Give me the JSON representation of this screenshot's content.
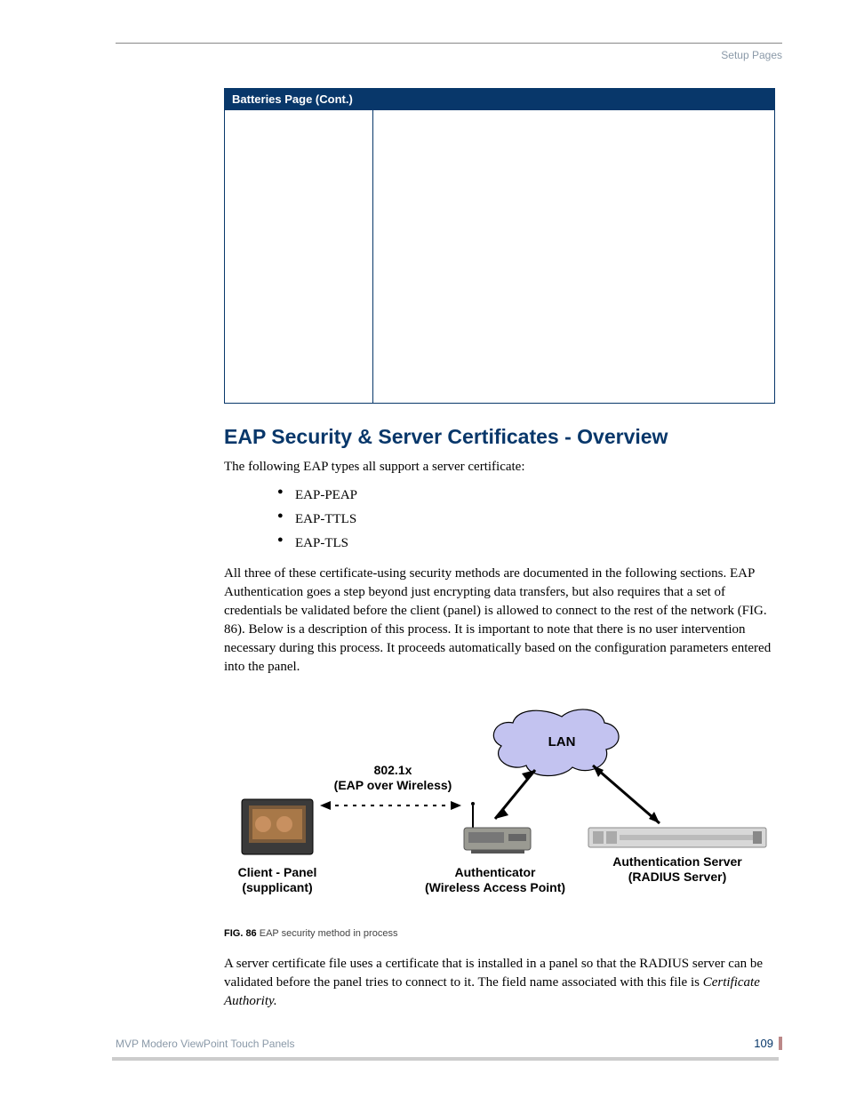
{
  "header": {
    "section": "Setup Pages"
  },
  "table": {
    "title": "Batteries Page (Cont.)"
  },
  "h1": "EAP Security & Server Certificates - Overview",
  "intro": "The following EAP types all support a server certificate:",
  "bullets": {
    "b0": "EAP-PEAP",
    "b1": "EAP-TTLS",
    "b2": "EAP-TLS"
  },
  "para2": "All three of these certificate-using security methods are documented in the following sections. EAP Authentication goes a step beyond just encrypting data transfers, but also requires that a set of credentials be validated before the client (panel) is allowed to connect to the rest of the network (FIG. 86). Below is a description of this process. It is important to note that there is no user intervention necessary during this process. It proceeds automatically based on the configuration parameters entered into the panel.",
  "figure": {
    "lan": "LAN",
    "eaplabel1": "802.1x",
    "eaplabel2": "(EAP over Wireless)",
    "client1": "Client - Panel",
    "client2": "(supplicant)",
    "auth1": "Authenticator",
    "auth2": "(Wireless Access Point)",
    "server1": "Authentication Server",
    "server2": "(RADIUS Server)",
    "caption_b": "FIG. 86",
    "caption_t": "  EAP security method in process"
  },
  "para3a": "A server certificate file uses a certificate that is installed in a panel so that the RADIUS server can be validated before the panel tries to connect to it. The field name associated with this file is ",
  "para3b": "Certificate Authority.",
  "footer": {
    "doc": "MVP Modero ViewPoint Touch Panels",
    "page": "109"
  }
}
